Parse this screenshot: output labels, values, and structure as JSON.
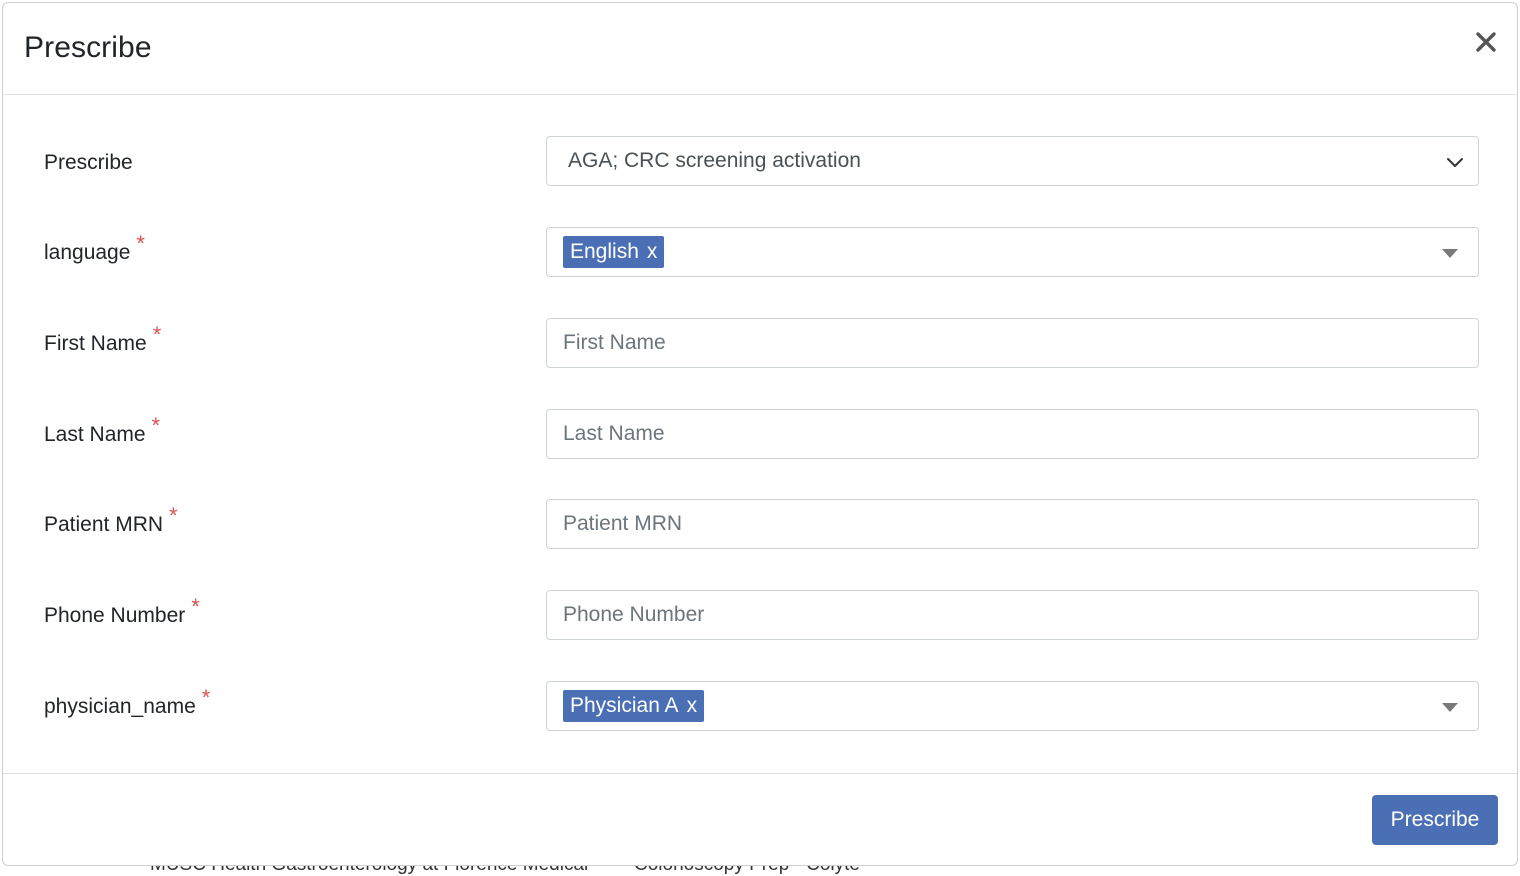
{
  "backdrop": {
    "left_text": "MUSC Health Gastroenterology at Florence Medical",
    "right_text": "Colonoscopy Prep - Colyte"
  },
  "modal": {
    "title": "Prescribe",
    "close_glyph": "×"
  },
  "form": {
    "prescribe": {
      "label": "Prescribe",
      "value": "AGA; CRC screening activation"
    },
    "language": {
      "label": "language",
      "required_mark": "*",
      "tag": "English",
      "tag_remove": "x"
    },
    "first_name": {
      "label": "First Name",
      "required_mark": "*",
      "placeholder": "First Name"
    },
    "last_name": {
      "label": "Last Name",
      "required_mark": "*",
      "placeholder": "Last Name"
    },
    "patient_mrn": {
      "label": "Patient MRN",
      "required_mark": "*",
      "placeholder": "Patient MRN"
    },
    "phone_number": {
      "label": "Phone Number",
      "required_mark": "*",
      "placeholder": "Phone Number"
    },
    "physician_name": {
      "label": "physician_name",
      "required_mark": "*",
      "tag": "Physician A",
      "tag_remove": "x"
    }
  },
  "footer": {
    "submit_label": "Prescribe"
  },
  "colors": {
    "accent": "#4a6fb5",
    "required": "#d9534f"
  },
  "icons": {
    "close": "close-icon",
    "select_chevron": "chevron-down-icon",
    "dropdown_caret": "caret-down-icon"
  }
}
